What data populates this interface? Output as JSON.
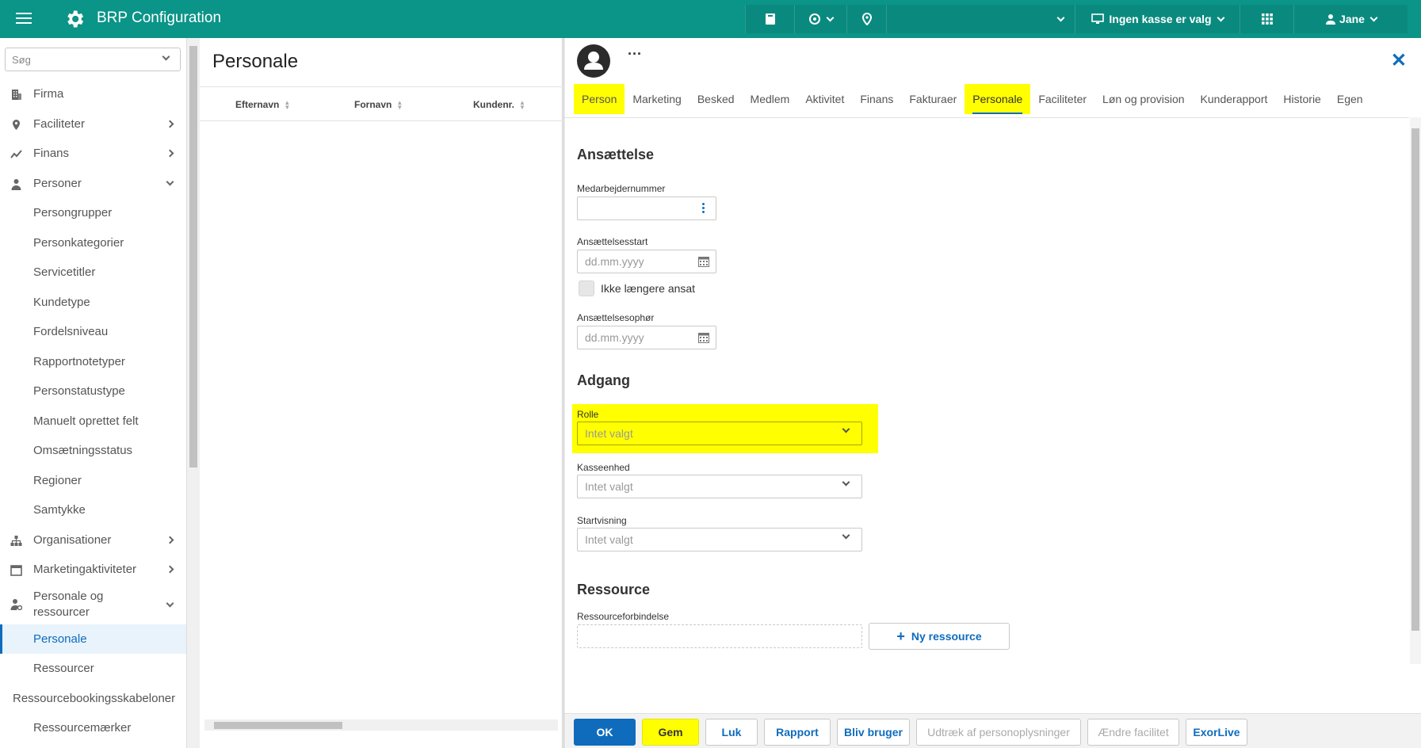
{
  "topbar": {
    "title": "BRP Configuration",
    "register_label": "Ingen kasse er valg",
    "user_label": "Jane"
  },
  "sidebar": {
    "search_placeholder": "Søg",
    "items": [
      {
        "label": "Firma"
      },
      {
        "label": "Faciliteter"
      },
      {
        "label": "Finans"
      },
      {
        "label": "Personer"
      },
      {
        "label": "Persongrupper"
      },
      {
        "label": "Personkategorier"
      },
      {
        "label": "Servicetitler"
      },
      {
        "label": "Kundetype"
      },
      {
        "label": "Fordelsniveau"
      },
      {
        "label": "Rapportnotetyper"
      },
      {
        "label": "Personstatustype"
      },
      {
        "label": "Manuelt oprettet felt"
      },
      {
        "label": "Omsætningsstatus"
      },
      {
        "label": "Regioner"
      },
      {
        "label": "Samtykke"
      },
      {
        "label": "Organisationer"
      },
      {
        "label": "Marketingaktiviteter"
      },
      {
        "label": "Personale og ressourcer"
      },
      {
        "label": "Personale"
      },
      {
        "label": "Ressourcer"
      },
      {
        "label": "Ressourcebookingsskabeloner"
      },
      {
        "label": "Ressourcemærker"
      }
    ]
  },
  "list": {
    "title": "Personale",
    "columns": [
      "Efternavn",
      "Fornavn",
      "Kundenr."
    ]
  },
  "detail": {
    "more_label": "···",
    "tabs": [
      "Person",
      "Marketing",
      "Besked",
      "Medlem",
      "Aktivitet",
      "Finans",
      "Fakturaer",
      "Personale",
      "Faciliteter",
      "Løn og provision",
      "Kunderapport",
      "Historie",
      "Egen"
    ],
    "sections": {
      "employment": "Ansættelse",
      "access": "Adgang",
      "resource": "Ressource"
    },
    "fields": {
      "employee_number_label": "Medarbejdernummer",
      "start_label": "Ansættelsesstart",
      "start_placeholder": "dd.mm.yyyy",
      "not_employed_label": "Ikke længere ansat",
      "end_label": "Ansættelsesophør",
      "end_placeholder": "dd.mm.yyyy",
      "role_label": "Rolle",
      "role_value": "Intet valgt",
      "cash_unit_label": "Kasseenhed",
      "cash_unit_value": "Intet valgt",
      "start_view_label": "Startvisning",
      "start_view_value": "Intet valgt",
      "resource_link_label": "Ressourceforbindelse",
      "new_resource_label": "Ny ressource"
    },
    "footer": {
      "ok": "OK",
      "save": "Gem",
      "close": "Luk",
      "report": "Rapport",
      "become_user": "Bliv bruger",
      "extract": "Udtræk af personoplysninger",
      "change_facility": "Ændre facilitet",
      "exorlive": "ExorLive"
    }
  },
  "colors": {
    "topbar": "#0b9488",
    "accent": "#0f6cbd",
    "highlight": "#ffff00"
  }
}
